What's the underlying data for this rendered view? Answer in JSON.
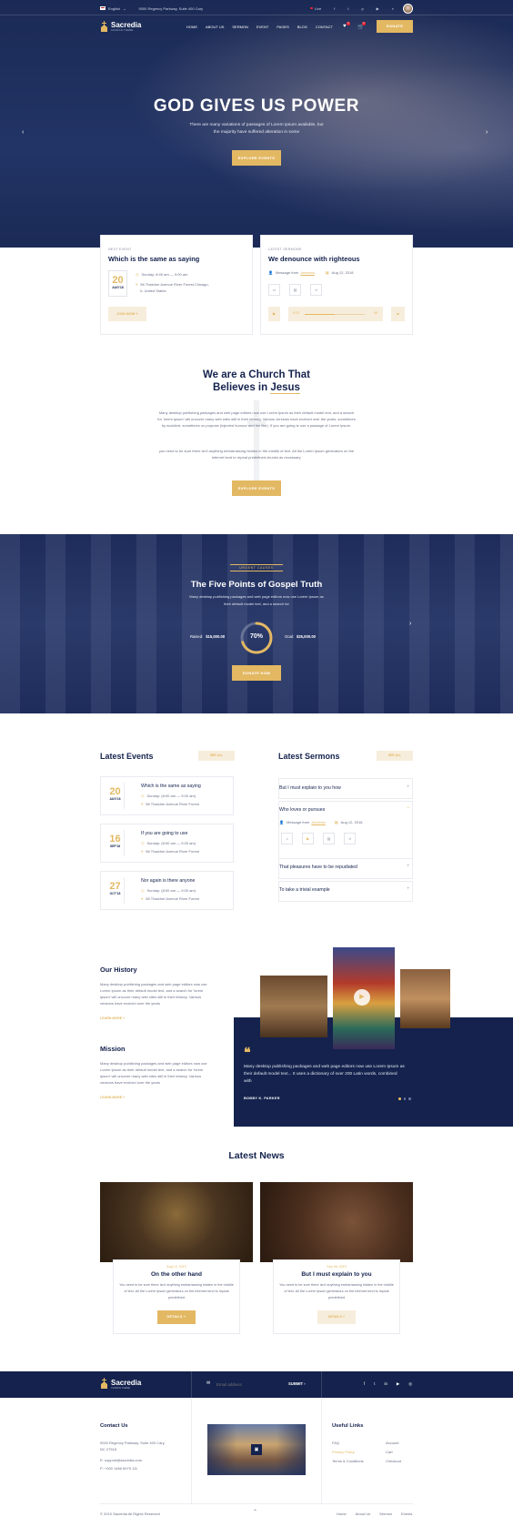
{
  "topbar": {
    "language": "English",
    "address": "9000 Regency Parkway, Suite 400 Cary",
    "live": "Live"
  },
  "brand": {
    "name": "Sacredia",
    "tagline": "CHURCH THEME"
  },
  "nav": {
    "items": [
      "HOME",
      "ABOUT US",
      "SERMON",
      "EVENT",
      "PAGES",
      "BLOG",
      "CONTACT"
    ],
    "donate": "DONATE",
    "wishlist_count": "0",
    "cart_count": "0"
  },
  "hero": {
    "title": "GOD GIVES US POWER",
    "subtitle_1": "There are many variations of passages of Lorem Ipsum available, but",
    "subtitle_2": "the majority have suffered alteration in some",
    "button": "EXPLORE EVENTS"
  },
  "next_event": {
    "label": "NEXT EVENT",
    "title": "Which is the same as saying",
    "day": "20",
    "month": "AUG'18",
    "time": "Sunday: 8:00 am — 9:00 am",
    "address_1": "56 Thatcher Avenue River Forest Chicago,",
    "address_2": "IL United States",
    "button": "JOIN NOW +"
  },
  "latest_sermons_card": {
    "label": "LATEST SERMONS",
    "title": "We denounce with righteous",
    "message_from": "Message from",
    "author": "Andrews",
    "date": "Aug 12, 2018",
    "time_now": "0:23",
    "time_total": "45"
  },
  "about": {
    "title_1": "We are a Church That",
    "title_2": "Believes in",
    "title_highlight": "Jesus",
    "para_1": "Many desktop publishing packages and web page editors now use Lorem Ipsum as their default model text, and a search for 'lorem ipsum' will uncover many web sites still in their infancy. Various versions have evolved over the years, sometimes by accident, sometimes on purpose (injected humour and the like). If you are going to use a passage of Lorem Ipsum.",
    "para_2": "you need to be sure there isn't anything embarrassing hidden in the middle of text. All the Lorem Ipsum generators on the Internet tend to repeat predefined chunks as necessary.",
    "button": "EXPLORE EVENTS"
  },
  "cause": {
    "badge": "URGENT CAUSES",
    "title": "The Five Points of Gospel Truth",
    "desc_1": "Many desktop publishing packages and web page editors now use Lorem Ipsum as",
    "desc_2": "their default model text, and a search for",
    "raised_label": "Raised:",
    "raised_value": "$15,000.00",
    "goal_label": "Goal:",
    "goal_value": "$25,000.00",
    "percent_text": "70%",
    "percent": 0.7,
    "button": "DONATE NOW"
  },
  "events_section": {
    "title": "Latest Events",
    "see_all": "SEE ALL",
    "items": [
      {
        "day": "20",
        "month": "AUG'18",
        "title": "Which is the same as saying",
        "time": "Sunday: (8:00 am — 9:00 am)",
        "address": "56 Thatcher Avenue River Forest"
      },
      {
        "day": "16",
        "month": "SEP'18",
        "title": "If you are going to use",
        "time": "Sunday: (8:00 am — 9:00 am)",
        "address": "56 Thatcher Avenue River Forest"
      },
      {
        "day": "27",
        "month": "OCT'18",
        "title": "Nor again is there anyone",
        "time": "Sunday: (8:00 am — 9:00 am)",
        "address": "56 Thatcher Avenue River Forest"
      }
    ]
  },
  "sermons_section": {
    "title": "Latest Sermons",
    "see_all": "SEE ALL",
    "items": [
      {
        "title": "But I must explain to you how"
      },
      {
        "title": "Who loves or pursues"
      },
      {
        "title": "That pleasures have to be repudiated"
      },
      {
        "title": "To take a trivial example"
      }
    ],
    "expanded_message_from": "Message from",
    "expanded_author": "Andrews",
    "expanded_date": "Aug 12, 2018"
  },
  "history": {
    "title": "Our History",
    "text": "Many desktop publishing packages and web page editors now use Lorem Ipsum as their default model text, and a search for 'lorem ipsum' will uncover many web sites still in their infancy. Various versions have evolved over the years",
    "link": "LEARN MORE +"
  },
  "mission": {
    "title": "Mission",
    "text": "Many desktop publishing packages and web page editors now use Lorem Ipsum as their default model text, and a search for 'lorem ipsum' will uncover many web sites still in their infancy. Various versions have evolved over the years",
    "link": "LEARN MORE +"
  },
  "testimonial": {
    "quote": "Many desktop publishing packages and web page editors now use Lorem Ipsum as their default model text... It uses a dictionary of over 200 Latin words, combined with",
    "author": "BOBBY K. PARKER"
  },
  "news": {
    "title": "Latest News",
    "items": [
      {
        "date": "Aug 12, 2019",
        "title": "On the other hand",
        "text": "You need to be sure there isn't anything embarrassing hidden in the middle of text. All the Lorem Ipsum generators on the Internet tend to repeat predefined",
        "button": "DETAILS +"
      },
      {
        "date": "Sep 06, 2019",
        "title": "But I must explain to you",
        "text": "You need to be sure there isn't anything embarrassing hidden in the middle of text. All the Lorem Ipsum generators on the Internet tend to repeat predefined",
        "button": "DETAILS +"
      }
    ]
  },
  "newsletter": {
    "placeholder": "Email address",
    "submit": "SUBMIT"
  },
  "footer": {
    "contact_title": "Contact Us",
    "address_1": "9000 Regency Parkway, Suite 400 Cary,",
    "address_2": "NC 27518",
    "email": "E:  support@sacredia.com",
    "phone": "P:  +000 1466 6979 111",
    "links_title": "Useful Links",
    "links_col1": [
      "FAQ",
      "Privacy Policy",
      "Terms & Conditions"
    ],
    "links_col2": [
      "Account",
      "Cart",
      "Checkout"
    ],
    "copyright": "© 2019 Sacredia All Rights Reserved",
    "bottom_links": [
      "Home",
      "About Us",
      "Sermon",
      "Events"
    ]
  }
}
